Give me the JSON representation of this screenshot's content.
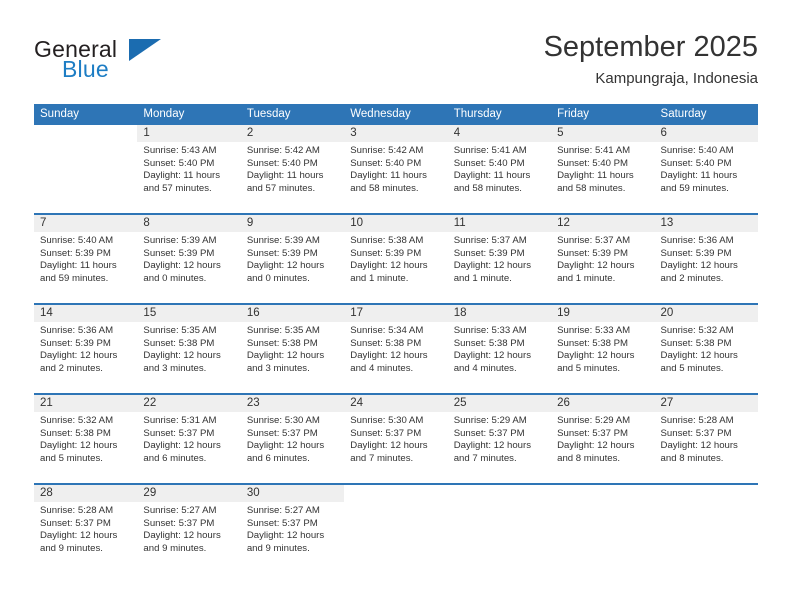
{
  "brand": {
    "word_one": "General",
    "word_two": "Blue",
    "logo_icon": "triangle-logo-icon",
    "accent_color": "#1b6cb0"
  },
  "header": {
    "title": "September 2025",
    "subtitle": "Kampungraja, Indonesia"
  },
  "calendar": {
    "header_bg": "#2e75b6",
    "daynum_bg": "#efefef",
    "weekdays": [
      "Sunday",
      "Monday",
      "Tuesday",
      "Wednesday",
      "Thursday",
      "Friday",
      "Saturday"
    ],
    "weeks": [
      [
        {
          "day": "",
          "sunrise": "",
          "sunset": "",
          "daylight_1": "",
          "daylight_2": ""
        },
        {
          "day": "1",
          "sunrise": "Sunrise: 5:43 AM",
          "sunset": "Sunset: 5:40 PM",
          "daylight_1": "Daylight: 11 hours",
          "daylight_2": "and 57 minutes."
        },
        {
          "day": "2",
          "sunrise": "Sunrise: 5:42 AM",
          "sunset": "Sunset: 5:40 PM",
          "daylight_1": "Daylight: 11 hours",
          "daylight_2": "and 57 minutes."
        },
        {
          "day": "3",
          "sunrise": "Sunrise: 5:42 AM",
          "sunset": "Sunset: 5:40 PM",
          "daylight_1": "Daylight: 11 hours",
          "daylight_2": "and 58 minutes."
        },
        {
          "day": "4",
          "sunrise": "Sunrise: 5:41 AM",
          "sunset": "Sunset: 5:40 PM",
          "daylight_1": "Daylight: 11 hours",
          "daylight_2": "and 58 minutes."
        },
        {
          "day": "5",
          "sunrise": "Sunrise: 5:41 AM",
          "sunset": "Sunset: 5:40 PM",
          "daylight_1": "Daylight: 11 hours",
          "daylight_2": "and 58 minutes."
        },
        {
          "day": "6",
          "sunrise": "Sunrise: 5:40 AM",
          "sunset": "Sunset: 5:40 PM",
          "daylight_1": "Daylight: 11 hours",
          "daylight_2": "and 59 minutes."
        }
      ],
      [
        {
          "day": "7",
          "sunrise": "Sunrise: 5:40 AM",
          "sunset": "Sunset: 5:39 PM",
          "daylight_1": "Daylight: 11 hours",
          "daylight_2": "and 59 minutes."
        },
        {
          "day": "8",
          "sunrise": "Sunrise: 5:39 AM",
          "sunset": "Sunset: 5:39 PM",
          "daylight_1": "Daylight: 12 hours",
          "daylight_2": "and 0 minutes."
        },
        {
          "day": "9",
          "sunrise": "Sunrise: 5:39 AM",
          "sunset": "Sunset: 5:39 PM",
          "daylight_1": "Daylight: 12 hours",
          "daylight_2": "and 0 minutes."
        },
        {
          "day": "10",
          "sunrise": "Sunrise: 5:38 AM",
          "sunset": "Sunset: 5:39 PM",
          "daylight_1": "Daylight: 12 hours",
          "daylight_2": "and 1 minute."
        },
        {
          "day": "11",
          "sunrise": "Sunrise: 5:37 AM",
          "sunset": "Sunset: 5:39 PM",
          "daylight_1": "Daylight: 12 hours",
          "daylight_2": "and 1 minute."
        },
        {
          "day": "12",
          "sunrise": "Sunrise: 5:37 AM",
          "sunset": "Sunset: 5:39 PM",
          "daylight_1": "Daylight: 12 hours",
          "daylight_2": "and 1 minute."
        },
        {
          "day": "13",
          "sunrise": "Sunrise: 5:36 AM",
          "sunset": "Sunset: 5:39 PM",
          "daylight_1": "Daylight: 12 hours",
          "daylight_2": "and 2 minutes."
        }
      ],
      [
        {
          "day": "14",
          "sunrise": "Sunrise: 5:36 AM",
          "sunset": "Sunset: 5:39 PM",
          "daylight_1": "Daylight: 12 hours",
          "daylight_2": "and 2 minutes."
        },
        {
          "day": "15",
          "sunrise": "Sunrise: 5:35 AM",
          "sunset": "Sunset: 5:38 PM",
          "daylight_1": "Daylight: 12 hours",
          "daylight_2": "and 3 minutes."
        },
        {
          "day": "16",
          "sunrise": "Sunrise: 5:35 AM",
          "sunset": "Sunset: 5:38 PM",
          "daylight_1": "Daylight: 12 hours",
          "daylight_2": "and 3 minutes."
        },
        {
          "day": "17",
          "sunrise": "Sunrise: 5:34 AM",
          "sunset": "Sunset: 5:38 PM",
          "daylight_1": "Daylight: 12 hours",
          "daylight_2": "and 4 minutes."
        },
        {
          "day": "18",
          "sunrise": "Sunrise: 5:33 AM",
          "sunset": "Sunset: 5:38 PM",
          "daylight_1": "Daylight: 12 hours",
          "daylight_2": "and 4 minutes."
        },
        {
          "day": "19",
          "sunrise": "Sunrise: 5:33 AM",
          "sunset": "Sunset: 5:38 PM",
          "daylight_1": "Daylight: 12 hours",
          "daylight_2": "and 5 minutes."
        },
        {
          "day": "20",
          "sunrise": "Sunrise: 5:32 AM",
          "sunset": "Sunset: 5:38 PM",
          "daylight_1": "Daylight: 12 hours",
          "daylight_2": "and 5 minutes."
        }
      ],
      [
        {
          "day": "21",
          "sunrise": "Sunrise: 5:32 AM",
          "sunset": "Sunset: 5:38 PM",
          "daylight_1": "Daylight: 12 hours",
          "daylight_2": "and 5 minutes."
        },
        {
          "day": "22",
          "sunrise": "Sunrise: 5:31 AM",
          "sunset": "Sunset: 5:37 PM",
          "daylight_1": "Daylight: 12 hours",
          "daylight_2": "and 6 minutes."
        },
        {
          "day": "23",
          "sunrise": "Sunrise: 5:30 AM",
          "sunset": "Sunset: 5:37 PM",
          "daylight_1": "Daylight: 12 hours",
          "daylight_2": "and 6 minutes."
        },
        {
          "day": "24",
          "sunrise": "Sunrise: 5:30 AM",
          "sunset": "Sunset: 5:37 PM",
          "daylight_1": "Daylight: 12 hours",
          "daylight_2": "and 7 minutes."
        },
        {
          "day": "25",
          "sunrise": "Sunrise: 5:29 AM",
          "sunset": "Sunset: 5:37 PM",
          "daylight_1": "Daylight: 12 hours",
          "daylight_2": "and 7 minutes."
        },
        {
          "day": "26",
          "sunrise": "Sunrise: 5:29 AM",
          "sunset": "Sunset: 5:37 PM",
          "daylight_1": "Daylight: 12 hours",
          "daylight_2": "and 8 minutes."
        },
        {
          "day": "27",
          "sunrise": "Sunrise: 5:28 AM",
          "sunset": "Sunset: 5:37 PM",
          "daylight_1": "Daylight: 12 hours",
          "daylight_2": "and 8 minutes."
        }
      ],
      [
        {
          "day": "28",
          "sunrise": "Sunrise: 5:28 AM",
          "sunset": "Sunset: 5:37 PM",
          "daylight_1": "Daylight: 12 hours",
          "daylight_2": "and 9 minutes."
        },
        {
          "day": "29",
          "sunrise": "Sunrise: 5:27 AM",
          "sunset": "Sunset: 5:37 PM",
          "daylight_1": "Daylight: 12 hours",
          "daylight_2": "and 9 minutes."
        },
        {
          "day": "30",
          "sunrise": "Sunrise: 5:27 AM",
          "sunset": "Sunset: 5:37 PM",
          "daylight_1": "Daylight: 12 hours",
          "daylight_2": "and 9 minutes."
        },
        {
          "day": "",
          "sunrise": "",
          "sunset": "",
          "daylight_1": "",
          "daylight_2": ""
        },
        {
          "day": "",
          "sunrise": "",
          "sunset": "",
          "daylight_1": "",
          "daylight_2": ""
        },
        {
          "day": "",
          "sunrise": "",
          "sunset": "",
          "daylight_1": "",
          "daylight_2": ""
        },
        {
          "day": "",
          "sunrise": "",
          "sunset": "",
          "daylight_1": "",
          "daylight_2": ""
        }
      ]
    ]
  }
}
